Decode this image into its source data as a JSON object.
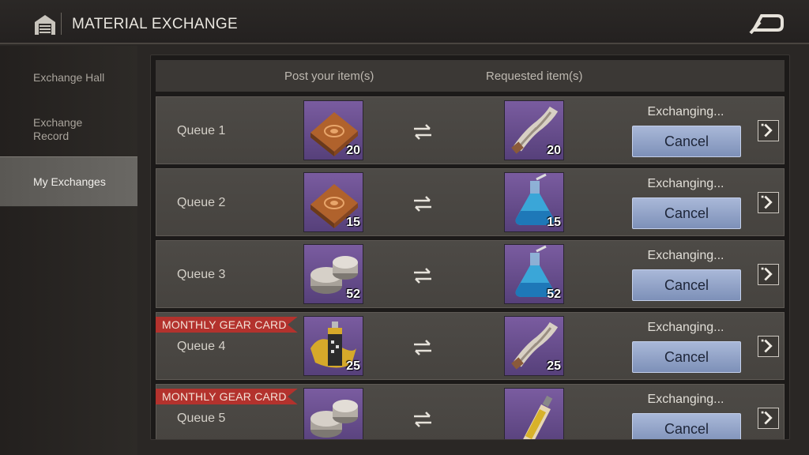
{
  "header": {
    "title": "MATERIAL EXCHANGE"
  },
  "sidebar": {
    "items": [
      {
        "label": "Exchange Hall"
      },
      {
        "label": "Exchange Record"
      },
      {
        "label": "My Exchanges"
      }
    ],
    "active": "My Exchanges"
  },
  "columns": {
    "post": "Post your item(s)",
    "requested": "Requested item(s)"
  },
  "queues": [
    {
      "label": "Queue 1",
      "badge": "",
      "post_item": "wooden-board",
      "post_qty": "20",
      "req_item": "twisted-rope",
      "req_qty": "20",
      "status": "Exchanging...",
      "button": "Cancel"
    },
    {
      "label": "Queue 2",
      "badge": "",
      "post_item": "wooden-board",
      "post_qty": "15",
      "req_item": "blue-flask",
      "req_qty": "15",
      "status": "Exchanging...",
      "button": "Cancel"
    },
    {
      "label": "Queue 3",
      "badge": "",
      "post_item": "metal-discs",
      "post_qty": "52",
      "req_item": "blue-flask",
      "req_qty": "52",
      "status": "Exchanging...",
      "button": "Cancel"
    },
    {
      "label": "Queue 4",
      "badge": "MONTHLY GEAR CARD",
      "post_item": "spray-can",
      "post_qty": "25",
      "req_item": "twisted-rope",
      "req_qty": "25",
      "status": "Exchanging...",
      "button": "Cancel"
    },
    {
      "label": "Queue 5",
      "badge": "MONTHLY GEAR CARD",
      "post_item": "metal-discs",
      "post_qty": "",
      "req_item": "glue-tube",
      "req_qty": "",
      "status": "Exchanging...",
      "button": "Cancel"
    }
  ],
  "colors": {
    "accent_button": "#8fa1c8",
    "badge": "#b3322d",
    "slot": "#6a4d8e"
  }
}
